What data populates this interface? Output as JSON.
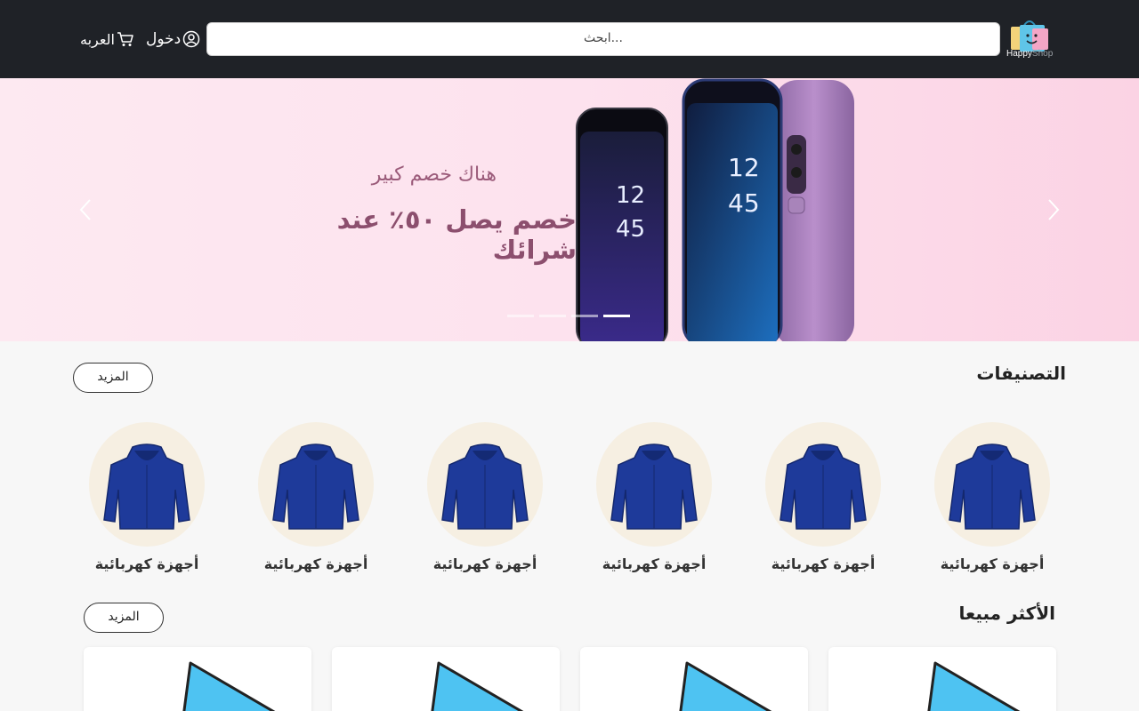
{
  "header": {
    "logo": {
      "text_a": "Happy",
      "text_b": "Shop",
      "icon": "shopping-bag-icon"
    },
    "search_placeholder": "ابحث...",
    "login_label": "دخول",
    "cart_label": "العربه"
  },
  "hero": {
    "subtitle": "هناك خصم كبير",
    "title": "خصم يصل ٥٠٪ عند شرائك",
    "slides": 4,
    "active_slide": 4
  },
  "categories": {
    "title": "التصنيفات",
    "more_label": "المزيد",
    "items": [
      {
        "label": "أجهزة كهربائية"
      },
      {
        "label": "أجهزة كهربائية"
      },
      {
        "label": "أجهزة كهربائية"
      },
      {
        "label": "أجهزة كهربائية"
      },
      {
        "label": "أجهزة كهربائية"
      },
      {
        "label": "أجهزة كهربائية"
      }
    ]
  },
  "best_sellers": {
    "title": "الأكثر مبيعا",
    "more_label": "المزيد"
  },
  "colors": {
    "header_bg": "#1f2227",
    "hero_text": "#8c4f6e",
    "category_bg": "#f6efe2",
    "hoodie": "#1e3a9a",
    "product_blue": "#4ec3f2"
  }
}
